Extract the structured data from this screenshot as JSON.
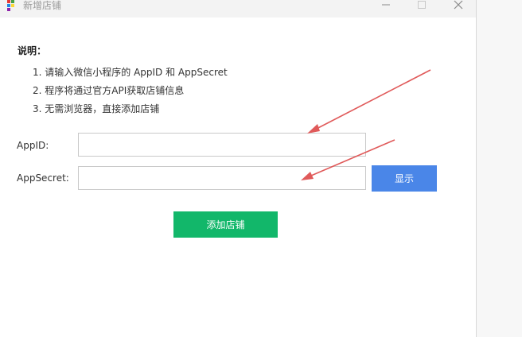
{
  "window": {
    "title": "新增店铺",
    "controls": {
      "minimize": "—",
      "maximize": "□",
      "close": "✕"
    }
  },
  "instructions": {
    "heading": "说明：",
    "items": [
      "1. 请输入微信小程序的 AppID 和 AppSecret",
      "2. 程序将通过官方API获取店铺信息",
      "3. 无需浏览器，直接添加店铺"
    ]
  },
  "form": {
    "appid_label": "AppID:",
    "appid_value": "",
    "appsecret_label": "AppSecret:",
    "appsecret_value": "",
    "show_button": "显示",
    "submit_button": "添加店铺"
  },
  "colors": {
    "primary_blue": "#4a86e8",
    "primary_green": "#12b76a",
    "annotation_red": "#e05a5a"
  },
  "icons": {
    "app": "app-grid-icon",
    "minimize": "minimize-icon",
    "maximize": "maximize-icon",
    "close": "close-icon"
  }
}
